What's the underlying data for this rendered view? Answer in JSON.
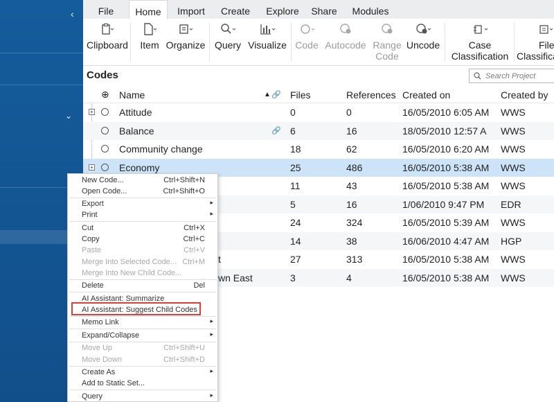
{
  "ribbon": {
    "tabs": [
      {
        "label": "File"
      },
      {
        "label": "Home"
      },
      {
        "label": "Import"
      },
      {
        "label": "Create"
      },
      {
        "label": "Explore"
      },
      {
        "label": "Share"
      },
      {
        "label": "Modules"
      }
    ],
    "active_tab": "Home",
    "buttons": [
      {
        "label": "Clipboard",
        "icon": "clipboard-icon",
        "enabled": true
      },
      {
        "label": "Item",
        "icon": "document-icon",
        "enabled": true
      },
      {
        "label": "Organize",
        "icon": "organize-icon",
        "enabled": true
      },
      {
        "label": "Query",
        "icon": "magnifier-icon",
        "enabled": true
      },
      {
        "label": "Visualize",
        "icon": "bar-chart-icon",
        "enabled": true
      },
      {
        "label": "Code",
        "icon": "circle-icon",
        "enabled": false
      },
      {
        "label": "Autocode",
        "icon": "autocode-icon",
        "enabled": false
      },
      {
        "label": "Range",
        "label2": "Code",
        "icon": "range-code-icon",
        "enabled": false
      },
      {
        "label": "Uncode",
        "icon": "uncode-icon",
        "enabled": true
      },
      {
        "label": "Case",
        "label2": "Classification",
        "icon": "case-classification-icon",
        "enabled": true
      },
      {
        "label": "File",
        "label2": "Classifica",
        "icon": "file-classification-icon",
        "enabled": true
      }
    ]
  },
  "codes": {
    "title": "Codes",
    "search_placeholder": "Search Project",
    "columns": [
      "Name",
      "Files",
      "References",
      "Created on",
      "Created by"
    ],
    "rows": [
      {
        "name": "Attitude",
        "files": "0",
        "references": "0",
        "created_on": "16/05/2010 6:05 AM",
        "created_by": "WWS",
        "expandable": true
      },
      {
        "name": "Balance",
        "files": "6",
        "references": "16",
        "created_on": "18/05/2010 12:57 A",
        "created_by": "WWS",
        "linked": true
      },
      {
        "name": "Community change",
        "files": "18",
        "references": "62",
        "created_on": "16/05/2010 6:20 AM",
        "created_by": "WWS"
      },
      {
        "name": "Economy",
        "files": "25",
        "references": "486",
        "created_on": "16/05/2010 5:38 AM",
        "created_by": "WWS",
        "expandable": true,
        "selected": true
      },
      {
        "name": "",
        "files": "11",
        "references": "43",
        "created_on": "16/05/2010 5:38 AM",
        "created_by": "WWS"
      },
      {
        "name": "",
        "files": "5",
        "references": "16",
        "created_on": "1/06/2010 9:47 PM",
        "created_by": "EDR"
      },
      {
        "name": "",
        "files": "24",
        "references": "324",
        "created_on": "16/05/2010 5:39 AM",
        "created_by": "WWS"
      },
      {
        "name": "",
        "files": "14",
        "references": "38",
        "created_on": "16/06/2010 4:47 AM",
        "created_by": "HGP"
      },
      {
        "name": "t",
        "files": "27",
        "references": "313",
        "created_on": "16/05/2010 5:38 AM",
        "created_by": "WWS"
      },
      {
        "name": "wn East",
        "files": "3",
        "references": "4",
        "created_on": "16/05/2010 5:38 AM",
        "created_by": "WWS"
      }
    ]
  },
  "context_menu": {
    "items": [
      {
        "label": "New Code...",
        "shortcut": "Ctrl+Shift+N"
      },
      {
        "label": "Open Code...",
        "shortcut": "Ctrl+Shift+O"
      },
      {
        "label": "Export",
        "submenu": true
      },
      {
        "label": "Print",
        "submenu": true
      },
      {
        "label": "Cut",
        "shortcut": "Ctrl+X"
      },
      {
        "label": "Copy",
        "shortcut": "Ctrl+C"
      },
      {
        "label": "Paste",
        "shortcut": "Ctrl+V",
        "disabled": true
      },
      {
        "label": "Merge Into Selected Code...",
        "shortcut": "Ctrl+M",
        "disabled": true
      },
      {
        "label": "Merge Into New Child Code...",
        "disabled": true
      },
      {
        "label": "Delete",
        "shortcut": "Del"
      },
      {
        "label": "AI Assistant: Summarize"
      },
      {
        "label": "AI Assistant: Suggest Child Codes",
        "highlighted": true
      },
      {
        "label": "Memo Link",
        "submenu": true
      },
      {
        "label": "Expand/Collapse",
        "submenu": true
      },
      {
        "label": "Move Up",
        "shortcut": "Ctrl+Shift+U",
        "disabled": true
      },
      {
        "label": "Move Down",
        "shortcut": "Ctrl+Shift+D",
        "disabled": true
      },
      {
        "label": "Create As",
        "submenu": true
      },
      {
        "label": "Add to Static Set..."
      },
      {
        "label": "Query",
        "submenu": true
      }
    ]
  },
  "colors": {
    "nav": "#155c9c",
    "selection": "#cde3f7",
    "highlight_box": "#e23b3b"
  }
}
